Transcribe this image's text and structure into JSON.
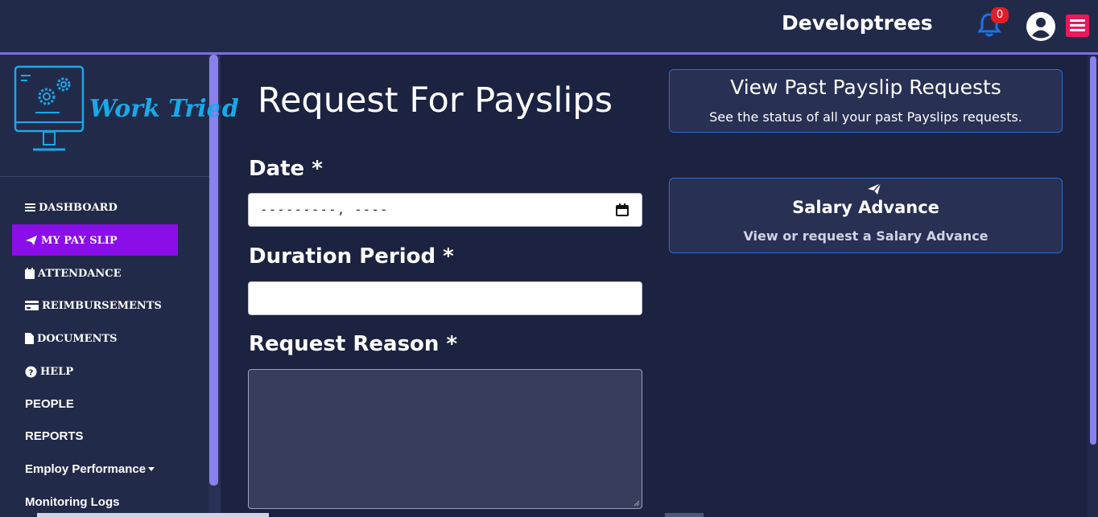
{
  "header": {
    "brand": "Developtrees",
    "notification_count": "0",
    "icons": [
      "bell-icon",
      "user-avatar-icon",
      "hamburger-menu-icon"
    ],
    "accent": "#7b6fe0"
  },
  "logo": {
    "text": "Work Tried"
  },
  "sidebar": {
    "items": [
      {
        "label": "DASHBOARD",
        "icon": "bars-icon"
      },
      {
        "label": "MY PAY SLIP",
        "icon": "paper-plane-icon",
        "active": true
      },
      {
        "label": "ATTENDANCE",
        "icon": "calendar-icon"
      },
      {
        "label": "REIMBURSEMENTS",
        "icon": "credit-card-icon"
      },
      {
        "label": "DOCUMENTS",
        "icon": "file-icon"
      },
      {
        "label": "HELP",
        "icon": "question-circle-icon"
      },
      {
        "label": "PEOPLE"
      },
      {
        "label": "REPORTS"
      },
      {
        "label": "Employ Performance",
        "icon": "caret-down-icon"
      },
      {
        "label": "Monitoring Logs"
      }
    ],
    "active_color": "#8a0ee8"
  },
  "form": {
    "title": "Request For Payslips",
    "date_label": "Date *",
    "date_placeholder": "---------, ----",
    "duration_label": "Duration Period *",
    "duration_value": "",
    "reason_label": "Request Reason *",
    "reason_value": ""
  },
  "cards": {
    "past": {
      "title": "View Past Payslip Requests",
      "subtitle": "See the status of all your past Payslips requests."
    },
    "advance": {
      "title": "Salary Advance",
      "subtitle": "View or request a Salary Advance",
      "icon": "paper-plane-icon"
    }
  }
}
